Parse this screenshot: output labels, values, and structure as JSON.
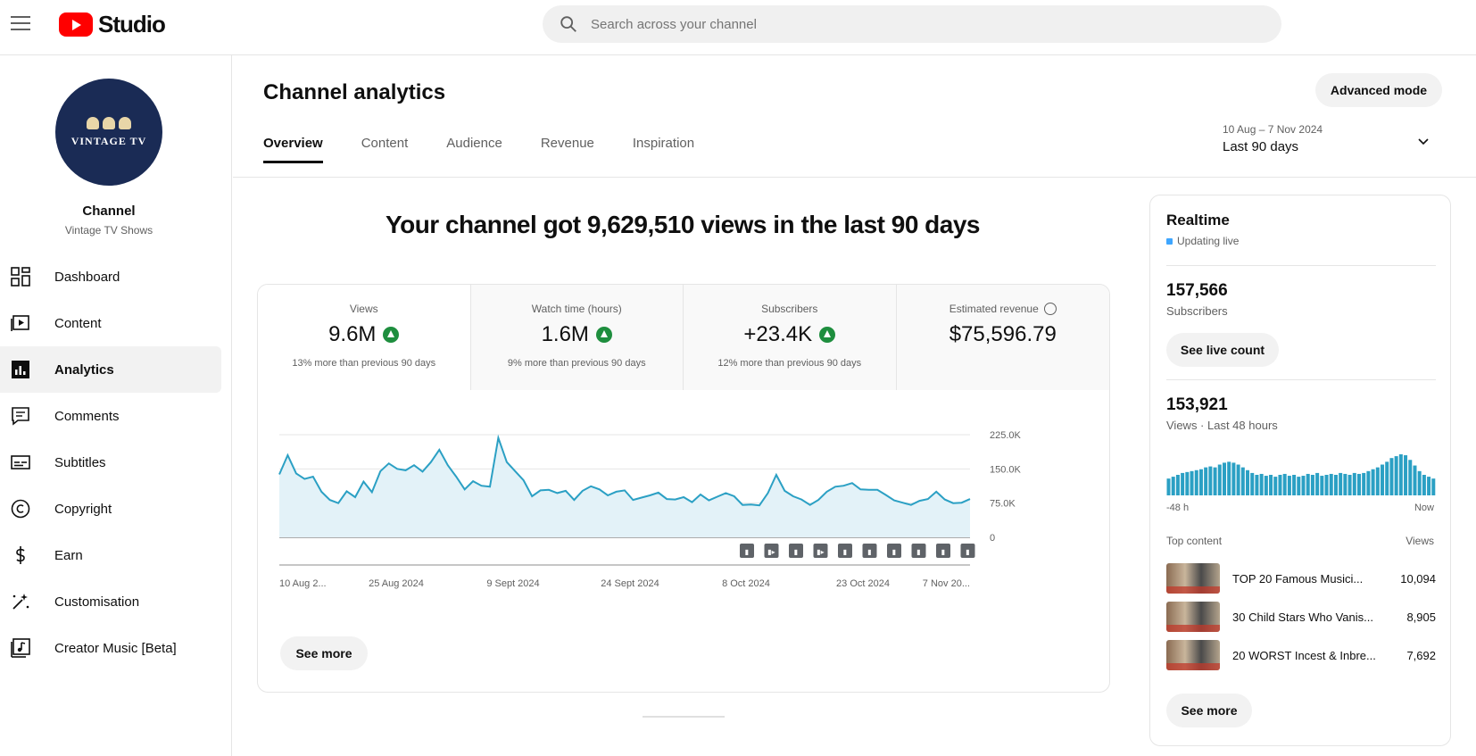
{
  "header": {
    "logo_text": "Studio",
    "search_placeholder": "Search across your channel"
  },
  "sidebar": {
    "avatar_text": "VINTAGE TV",
    "channel_name": "Channel",
    "channel_handle": "Vintage TV Shows",
    "items": [
      {
        "label": "Dashboard",
        "icon": "dashboard-icon",
        "active": false
      },
      {
        "label": "Content",
        "icon": "content-icon",
        "active": false
      },
      {
        "label": "Analytics",
        "icon": "analytics-icon",
        "active": true
      },
      {
        "label": "Comments",
        "icon": "comments-icon",
        "active": false
      },
      {
        "label": "Subtitles",
        "icon": "subtitles-icon",
        "active": false
      },
      {
        "label": "Copyright",
        "icon": "copyright-icon",
        "active": false
      },
      {
        "label": "Earn",
        "icon": "earn-icon",
        "active": false
      },
      {
        "label": "Customisation",
        "icon": "customisation-icon",
        "active": false
      },
      {
        "label": "Creator Music [Beta]",
        "icon": "creator-music-icon",
        "active": false
      }
    ]
  },
  "page": {
    "title": "Channel analytics",
    "advanced_mode": "Advanced mode",
    "tabs": [
      {
        "label": "Overview",
        "active": true
      },
      {
        "label": "Content",
        "active": false
      },
      {
        "label": "Audience",
        "active": false
      },
      {
        "label": "Revenue",
        "active": false
      },
      {
        "label": "Inspiration",
        "active": false
      }
    ],
    "date_range": "10 Aug – 7 Nov 2024",
    "date_label": "Last 90 days",
    "headline": "Your channel got 9,629,510 views in the last 90 days"
  },
  "metrics": [
    {
      "label": "Views",
      "value": "9.6M",
      "trend": "up",
      "sub": "13% more than previous 90 days"
    },
    {
      "label": "Watch time (hours)",
      "value": "1.6M",
      "trend": "up",
      "sub": "9% more than previous 90 days"
    },
    {
      "label": "Subscribers",
      "value": "+23.4K",
      "trend": "up",
      "sub": "12% more than previous 90 days"
    },
    {
      "label": "Estimated revenue",
      "value": "$75,596.79",
      "trend": "none",
      "sub": ""
    }
  ],
  "chart_data": {
    "type": "area",
    "title": "",
    "xlabel": "",
    "ylabel": "",
    "ylim": [
      0,
      225000
    ],
    "yticks": [
      0,
      75000,
      150000,
      225000
    ],
    "ytick_labels": [
      "0",
      "75.0K",
      "150.0K",
      "225.0K"
    ],
    "x_tick_labels": [
      "10 Aug 2...",
      "25 Aug 2024",
      "9 Sept 2024",
      "24 Sept 2024",
      "8 Oct 2024",
      "23 Oct 2024",
      "7 Nov 20..."
    ],
    "grid": true,
    "color": "#2ba0c4",
    "series": [
      {
        "values": [
          138000,
          180000,
          140000,
          128000,
          133000,
          100000,
          82000,
          75000,
          101000,
          88000,
          122000,
          99000,
          145000,
          162000,
          150000,
          147000,
          158000,
          144000,
          165000,
          192000,
          158000,
          133000,
          105000,
          123000,
          113000,
          111000,
          218000,
          165000,
          145000,
          125000,
          90000,
          103000,
          104000,
          97000,
          102000,
          82000,
          102000,
          112000,
          105000,
          92000,
          100000,
          103000,
          82000,
          87000,
          92000,
          98000,
          84000,
          83000,
          88000,
          77000,
          94000,
          81000,
          89000,
          97000,
          90000,
          71000,
          72000,
          70000,
          97000,
          137000,
          102000,
          90000,
          83000,
          71000,
          82000,
          100000,
          111000,
          113000,
          119000,
          105000,
          104000,
          104000,
          93000,
          81000,
          76000,
          71000,
          80000,
          84000,
          100000,
          83000,
          75000,
          76000,
          84000
        ]
      }
    ],
    "annotation_markers": [
      "▮",
      "▮▸",
      "▮",
      "▮▸",
      "▮",
      "▮",
      "▮",
      "▮",
      "▮",
      "▮"
    ]
  },
  "see_more": "See more",
  "realtime": {
    "title": "Realtime",
    "status": "Updating live",
    "subscribers": "157,566",
    "subscribers_label": "Subscribers",
    "see_live_count": "See live count",
    "views": "153,921",
    "views_label": "Views · Last 48 hours",
    "axis_start": "-48 h",
    "axis_end": "Now",
    "bars": [
      18,
      20,
      22,
      24,
      25,
      26,
      27,
      28,
      30,
      31,
      30,
      33,
      35,
      36,
      35,
      33,
      30,
      27,
      24,
      22,
      23,
      21,
      22,
      20,
      22,
      23,
      21,
      22,
      20,
      21,
      23,
      22,
      24,
      21,
      22,
      23,
      22,
      24,
      23,
      22,
      24,
      23,
      24,
      26,
      28,
      30,
      33,
      36,
      40,
      42,
      44,
      43,
      38,
      32,
      26,
      22,
      20,
      18
    ],
    "top_content_label": "Top content",
    "top_content_views_label": "Views",
    "top_content": [
      {
        "title": "TOP 20 Famous Musici...",
        "views": "10,094"
      },
      {
        "title": "30 Child Stars Who Vanis...",
        "views": "8,905"
      },
      {
        "title": "20 WORST Incest & Inbre...",
        "views": "7,692"
      }
    ],
    "see_more": "See more"
  }
}
